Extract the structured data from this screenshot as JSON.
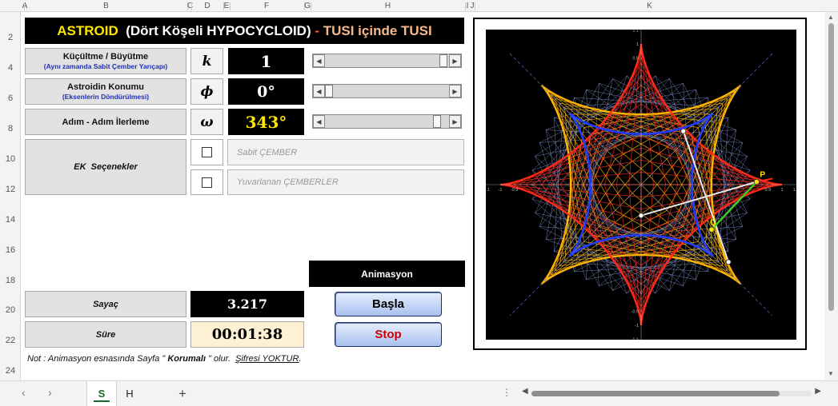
{
  "columns": [
    "A",
    "B",
    "C",
    "D",
    "E",
    "F",
    "G",
    "H",
    "I",
    "J",
    "K"
  ],
  "rows": [
    "2",
    "4",
    "6",
    "8",
    "10",
    "12",
    "14",
    "16",
    "18",
    "20",
    "22",
    "24"
  ],
  "title": {
    "part1": "ASTROID",
    "part2": "(Dört Köşeli HYPOCYCLOID)",
    "part3": " - ",
    "part4": "TUSI içinde TUSI"
  },
  "controls": {
    "scale": {
      "label": "Küçültme / Büyütme",
      "sub": "(Aynı zamanda Sabit Çember Yarıçapı)",
      "symbol": "k",
      "value": "1",
      "slider_fraction": 0.95
    },
    "position": {
      "label": "Astroidin Konumu",
      "sub": "(Eksenlerin Döndürülmesi)",
      "symbol": "ϕ",
      "value": "0°",
      "slider_fraction": 0.0
    },
    "step": {
      "label": "Adım - Adım İlerleme",
      "symbol": "ω",
      "value": "343°",
      "slider_fraction": 0.95
    }
  },
  "extra": {
    "label": "EK  Seçenekler",
    "option1": "Sabit ÇEMBER",
    "option2": "Yuvarlanan ÇEMBERLER"
  },
  "counter": {
    "label": "Sayaç",
    "value": "3.217"
  },
  "duration": {
    "label": "Süre",
    "value": "00:01:38"
  },
  "animation": {
    "header": "Animasyon",
    "start_label": "Başla",
    "stop_label": "Stop"
  },
  "note": {
    "prefix": "Not : Animasyon esnasında Sayfa \"",
    "bold": " Korumalı ",
    "middle": "\" olur.  ",
    "link": "Şifresi YOKTUR",
    "suffix": "."
  },
  "sheets": {
    "tab1": "S",
    "tab2": "H",
    "add": "+"
  },
  "chart_data": {
    "type": "line",
    "xlim": [
      -1.1,
      1.1
    ],
    "ylim": [
      -1.1,
      1.1
    ],
    "x_ticks": [
      "-1.1",
      "-1",
      "-0.9",
      "0.9",
      "1",
      "1.1"
    ],
    "y_ticks": [
      "1.1",
      "1",
      "0.9",
      "-0.9",
      "-1",
      "-1.1"
    ],
    "point_labels": [
      "P",
      "Q"
    ],
    "curve": "astroid",
    "colors": {
      "background": "#000000",
      "astroid": "#1f3cff",
      "outer": "#ffb400",
      "inner": "#ff2a1a",
      "mesh": "#9fb6ff"
    }
  },
  "colors": {
    "title_bg": "#000000",
    "value_white": "#ffffff",
    "value_yellow": "#ffe600",
    "button_stop": "#d00000",
    "button_start": "#000000"
  }
}
